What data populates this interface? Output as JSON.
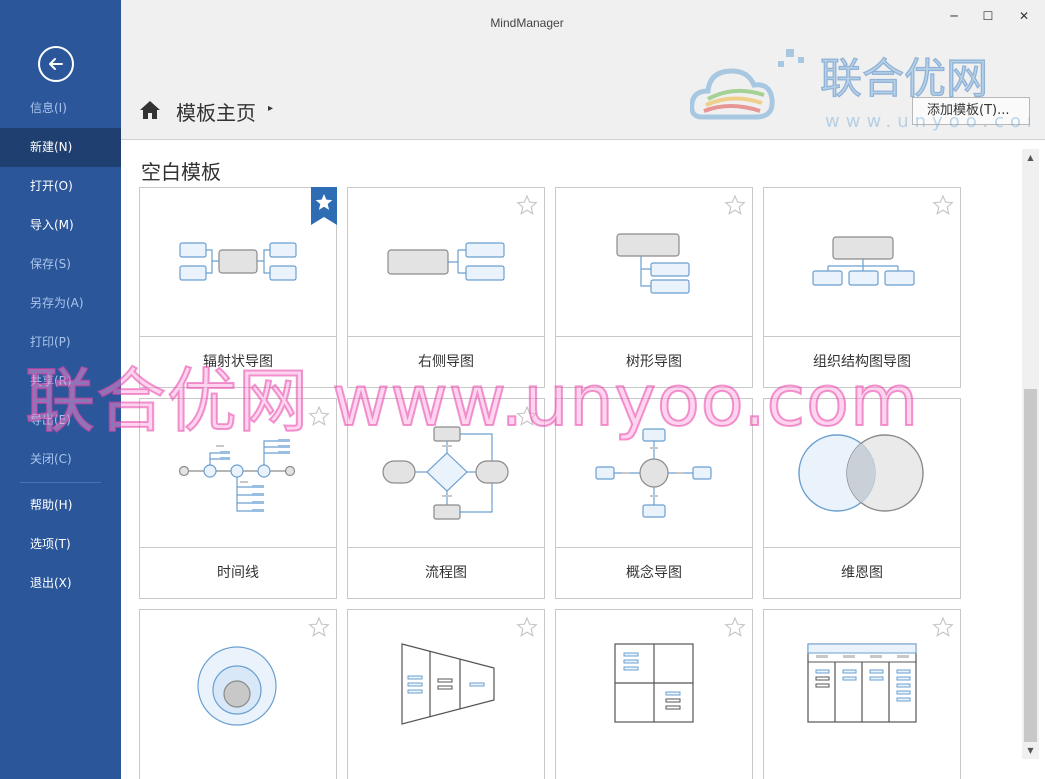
{
  "window": {
    "title": "MindManager",
    "minimize": "─",
    "maximize": "☐",
    "close": "✕"
  },
  "sidebar": {
    "items": [
      {
        "label": "信息(I)",
        "state": "dim"
      },
      {
        "label": "新建(N)",
        "state": "active"
      },
      {
        "label": "打开(O)",
        "state": "normal"
      },
      {
        "label": "导入(M)",
        "state": "normal"
      },
      {
        "label": "保存(S)",
        "state": "dim"
      },
      {
        "label": "另存为(A)",
        "state": "dim"
      },
      {
        "label": "打印(P)",
        "state": "dim"
      },
      {
        "label": "共享(R)",
        "state": "dim"
      },
      {
        "label": "导出(E)",
        "state": "dim"
      },
      {
        "label": "关闭(C)",
        "state": "dim"
      }
    ],
    "bottom_items": [
      {
        "label": "帮助(H)"
      },
      {
        "label": "选项(T)"
      },
      {
        "label": "退出(X)"
      }
    ]
  },
  "header": {
    "title": "模板主页",
    "arrow": "▸",
    "add_template": "添加模板(T)..."
  },
  "section": {
    "title": "空白模板"
  },
  "templates": {
    "radial": {
      "label": "辐射状导图"
    },
    "right": {
      "label": "右侧导图"
    },
    "tree": {
      "label": "树形导图"
    },
    "org": {
      "label": "组织结构图导图"
    },
    "timeline": {
      "label": "时间线"
    },
    "flow": {
      "label": "流程图"
    },
    "concept": {
      "label": "概念导图"
    },
    "venn": {
      "label": "维恩图"
    }
  },
  "watermark": {
    "brand": "联合优网",
    "domain": "www.unyoo.com",
    "overlay": "联合优网 www.unyoo.com"
  },
  "colors": {
    "sidebar": "#2b579a",
    "sidebar_active": "#1e3f6f",
    "accent": "#2e6db4",
    "node_fill": "#eaf3fc",
    "node_stroke": "#6a9fd0"
  }
}
